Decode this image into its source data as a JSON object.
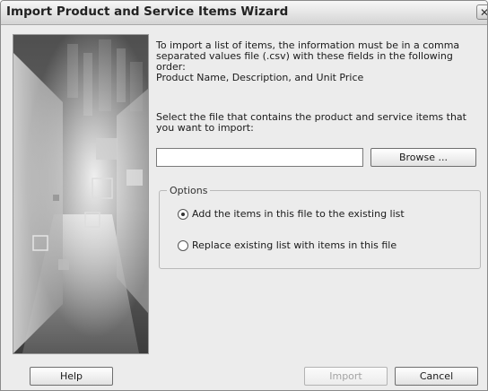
{
  "window": {
    "title": "Import Product and Service Items Wizard",
    "close_glyph": "✕"
  },
  "intro": {
    "text": "To import a list of items, the information must be in a comma separated values file (.csv) with these fields in the following order:\nProduct Name, Description, and Unit Price"
  },
  "file_select": {
    "prompt": "Select the file that contains the product and service items that you want to import:",
    "value": "",
    "browse_label": "Browse ..."
  },
  "options": {
    "legend": "Options",
    "items": [
      {
        "label": "Add the items in this file to the existing list",
        "selected": true
      },
      {
        "label": "Replace existing list with items in this file",
        "selected": false
      }
    ]
  },
  "footer": {
    "help_label": "Help",
    "import_label": "Import",
    "import_enabled": false,
    "cancel_label": "Cancel"
  },
  "icons": {
    "close": "close-icon",
    "radio_selected": "radio-selected-icon",
    "radio_unselected": "radio-unselected-icon"
  },
  "colors": {
    "dialog_background": "#ececec",
    "disabled_text": "#a3a3a3"
  }
}
